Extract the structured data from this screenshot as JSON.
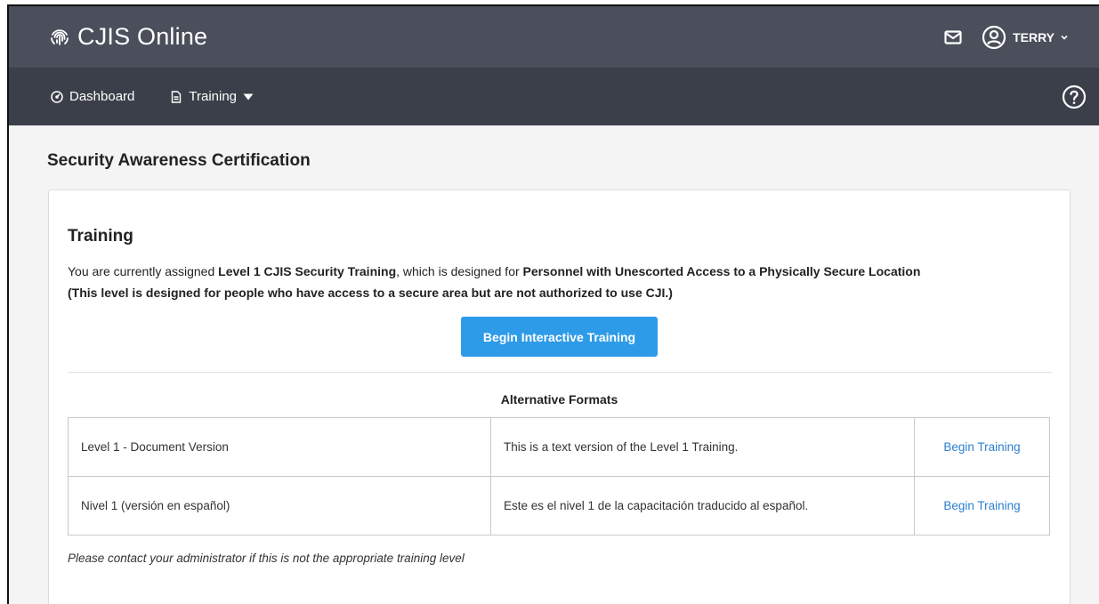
{
  "app": {
    "title": "CJIS Online"
  },
  "user": {
    "name": "TERRY"
  },
  "nav": {
    "dashboard": "Dashboard",
    "training": "Training"
  },
  "page": {
    "title": "Security Awareness Certification"
  },
  "training": {
    "heading": "Training",
    "desc_prefix": "You are currently assigned ",
    "level": "Level 1 CJIS Security Training",
    "desc_middle": ", which is designed for ",
    "audience": "Personnel with Unescorted Access to a Physically Secure Location",
    "note": "(This level is designed for people who have access to a secure area but are not authorized to use CJI.)",
    "begin_button": "Begin Interactive Training"
  },
  "alternatives": {
    "title": "Alternative Formats",
    "rows": [
      {
        "name": "Level 1 - Document Version",
        "description": "This is a text version of the Level 1 Training.",
        "action": "Begin Training"
      },
      {
        "name": "Nivel 1 (versión en español)",
        "description": "Este es el nivel 1 de la capacitación traducido al español.",
        "action": "Begin Training"
      }
    ]
  },
  "footer_note": "Please contact your administrator if this is not the appropriate training level",
  "icons": {
    "brand": "fingerprint-icon",
    "mail": "mail-icon",
    "user": "user-circle-icon",
    "dashboard": "speedometer-icon",
    "training": "document-icon",
    "help": "help-circle-icon"
  },
  "colors": {
    "topbar": "#4a4f5b",
    "navbar": "#3b3f49",
    "primary_button": "#2e9be8",
    "link": "#2c7fd0",
    "page_bg": "#f4f4f5"
  }
}
